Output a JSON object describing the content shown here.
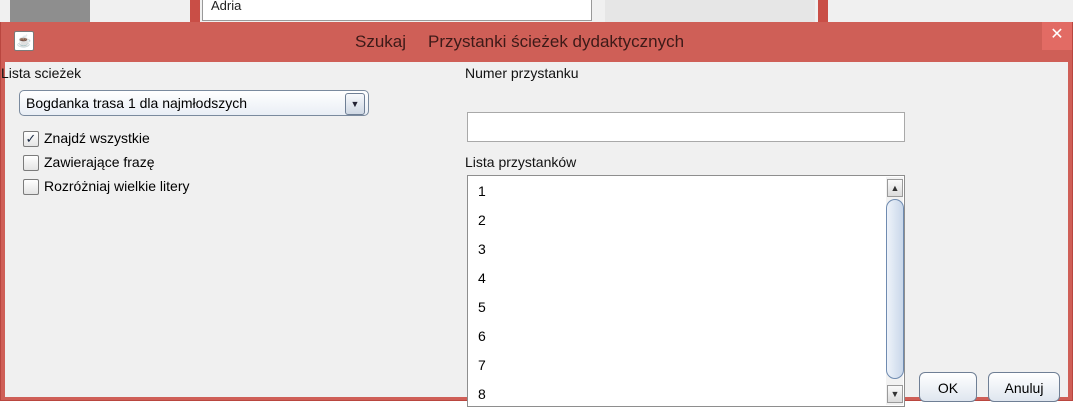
{
  "background": {
    "field_text": "Adria"
  },
  "dialog": {
    "title_part1": "Szukaj",
    "title_part2": "Przystanki ścieżek dydaktycznych",
    "close_glyph": "✕",
    "colors": {
      "titlebar": "#cf5f57",
      "client": "#f0f0f0"
    }
  },
  "left_panel": {
    "paths_label": "Lista scieżek",
    "selected_path": "Bogdanka trasa 1 dla najmłodszych",
    "checkboxes": [
      {
        "label": "Znajdź wszystkie",
        "checked": true
      },
      {
        "label": "Zawierające frazę",
        "checked": false
      },
      {
        "label": "Rozróżniaj wielkie litery",
        "checked": false
      }
    ]
  },
  "right_panel": {
    "stop_number_label": "Numer przystanku",
    "stop_number_value": "",
    "stops_list_label": "Lista przystanków",
    "stops": [
      "1",
      "2",
      "3",
      "4",
      "5",
      "6",
      "7",
      "8"
    ]
  },
  "buttons": {
    "ok": "OK",
    "cancel": "Anuluj"
  },
  "icons": {
    "app": "java-icon",
    "dropdown": "chevron-down-icon",
    "scroll_up": "arrow-up-icon",
    "scroll_down": "arrow-down-icon"
  }
}
